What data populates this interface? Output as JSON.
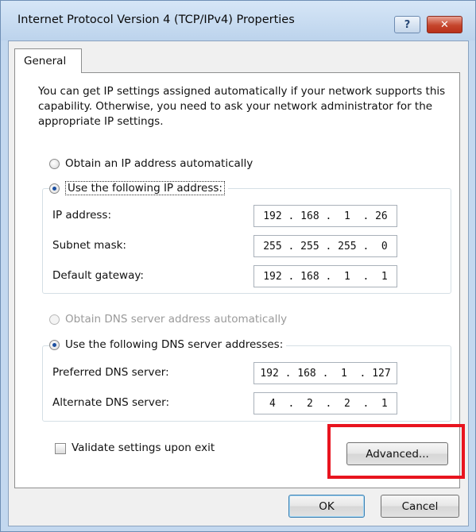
{
  "window": {
    "title": "Internet Protocol Version 4 (TCP/IPv4) Properties",
    "help_glyph": "?",
    "close_glyph": "✕"
  },
  "tabs": [
    {
      "label": "General"
    }
  ],
  "description": "You can get IP settings assigned automatically if your network supports this capability. Otherwise, you need to ask your network administrator for the appropriate IP settings.",
  "ip": {
    "auto": {
      "label": "Obtain an IP address automatically",
      "checked": false
    },
    "manual": {
      "label": "Use the following IP address:",
      "checked": true
    },
    "fields": [
      {
        "label": "IP address:",
        "value": "192 . 168 .  1  . 26"
      },
      {
        "label": "Subnet mask:",
        "value": "255 . 255 . 255 .  0"
      },
      {
        "label": "Default gateway:",
        "value": "192 . 168 .  1  .  1"
      }
    ]
  },
  "dns": {
    "auto": {
      "label": "Obtain DNS server address automatically",
      "checked": false,
      "disabled": true
    },
    "manual": {
      "label": "Use the following DNS server addresses:",
      "checked": true
    },
    "fields": [
      {
        "label": "Preferred DNS server:",
        "value": "192 . 168 .  1  . 127"
      },
      {
        "label": "Alternate DNS server:",
        "value": " 4  .  2  .  2  .  1"
      }
    ]
  },
  "validate": {
    "label": "Validate settings upon exit",
    "checked": false
  },
  "buttons": {
    "advanced": "Advanced...",
    "ok": "OK",
    "cancel": "Cancel"
  },
  "colors": {
    "highlight": "#e8141f",
    "titlebar": "#c3d8ef",
    "close": "#c5452c"
  }
}
